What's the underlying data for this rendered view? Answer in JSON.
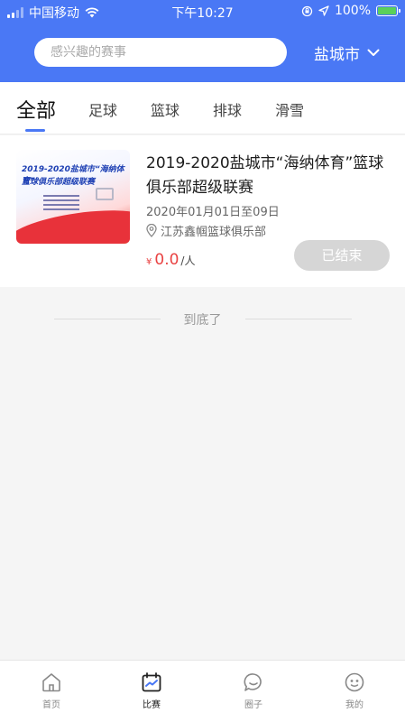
{
  "status_bar": {
    "carrier": "中国移动",
    "time": "下午10:27",
    "battery": "100%"
  },
  "search": {
    "placeholder": "感兴趣的赛事"
  },
  "city": {
    "label": "盐城市"
  },
  "tabs": [
    {
      "label": "全部",
      "active": true
    },
    {
      "label": "足球"
    },
    {
      "label": "篮球"
    },
    {
      "label": "排球"
    },
    {
      "label": "滑雪"
    }
  ],
  "events": [
    {
      "title": "2019-2020盐城市“海纳体育”篮球俱乐部超级联赛",
      "poster_line1": "2019-2020盐城市“海纳体育”",
      "poster_line2": "篮球俱乐部超级联赛",
      "date": "2020年01月01日至09日",
      "venue": "江苏鑫帼篮球俱乐部",
      "currency": "¥",
      "price": "0.0",
      "price_unit": "/人",
      "status": "已结束"
    }
  ],
  "end_text": "到底了",
  "bottom_nav": [
    {
      "label": "首页",
      "icon": "home-icon"
    },
    {
      "label": "比赛",
      "icon": "calendar-icon",
      "active": true
    },
    {
      "label": "圈子",
      "icon": "chat-bubble-icon"
    },
    {
      "label": "我的",
      "icon": "profile-icon"
    }
  ],
  "colors": {
    "brand": "#4a78f5",
    "price": "#e94242",
    "disabled_button": "#d6d6d6"
  }
}
